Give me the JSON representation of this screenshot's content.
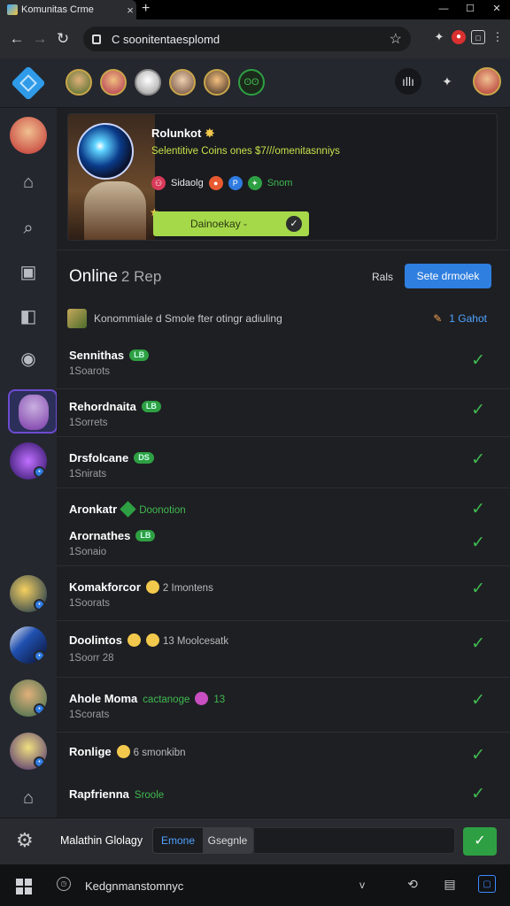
{
  "browser": {
    "tab_title": "Komunitas Crme",
    "tab_close": "×",
    "new_tab": "+",
    "win_min": "—",
    "win_max": "☐",
    "win_close": "✕",
    "url": "C soonitentaesplomd"
  },
  "profile_card": {
    "name": "Rolunkot",
    "subtitle": "Selentitive Coins ones $7///omenitasnniys",
    "tag_1": "Sidaolg",
    "tag_2": "Snom",
    "button_label": "Dainoekay -"
  },
  "online": {
    "title": "Online",
    "count": "2 Rep",
    "rule_label": "Rals",
    "action_button": "Sete drmolek",
    "subrow_text": "Konommiale d Smole fter otingr adiuling",
    "subrow_right_count": "1",
    "subrow_right_label": "Gahot"
  },
  "members": [
    {
      "name": "Sennithas",
      "pill": "LB",
      "sub": "1Soarots"
    },
    {
      "name": "Rehordnaita",
      "pill": "LB",
      "sub": "1Sorrets"
    },
    {
      "name": "Drsfolcane",
      "pill": "DS",
      "sub": "1Snirats"
    },
    {
      "name": "Aronkatr",
      "tag": "Doonotion",
      "sub": ""
    },
    {
      "name": "Arornathes",
      "pill": "LB",
      "sub": "1Sonaio"
    },
    {
      "name": "Komakforcor",
      "meta": "2 Imontens",
      "sub": "1Soorats"
    },
    {
      "name": "Doolintos",
      "meta": "13 Moolcesatk",
      "sub": "1Soorr 28"
    },
    {
      "name": "Ahole Moma",
      "tag": "cactanoge",
      "meta": "13",
      "sub": "1Scorats"
    },
    {
      "name": "Ronlige",
      "meta": "6 smonkibn",
      "sub": ""
    },
    {
      "name": "Rapfrienna",
      "tag": "Sroole",
      "sub": ""
    }
  ],
  "bottom": {
    "name": "Malathin Glolagy",
    "seg_a": "Emone",
    "seg_b": "Gsegnle",
    "send": "✓"
  },
  "taskbar": {
    "search": "Kedgnmanstomnyc",
    "chev": "v"
  }
}
